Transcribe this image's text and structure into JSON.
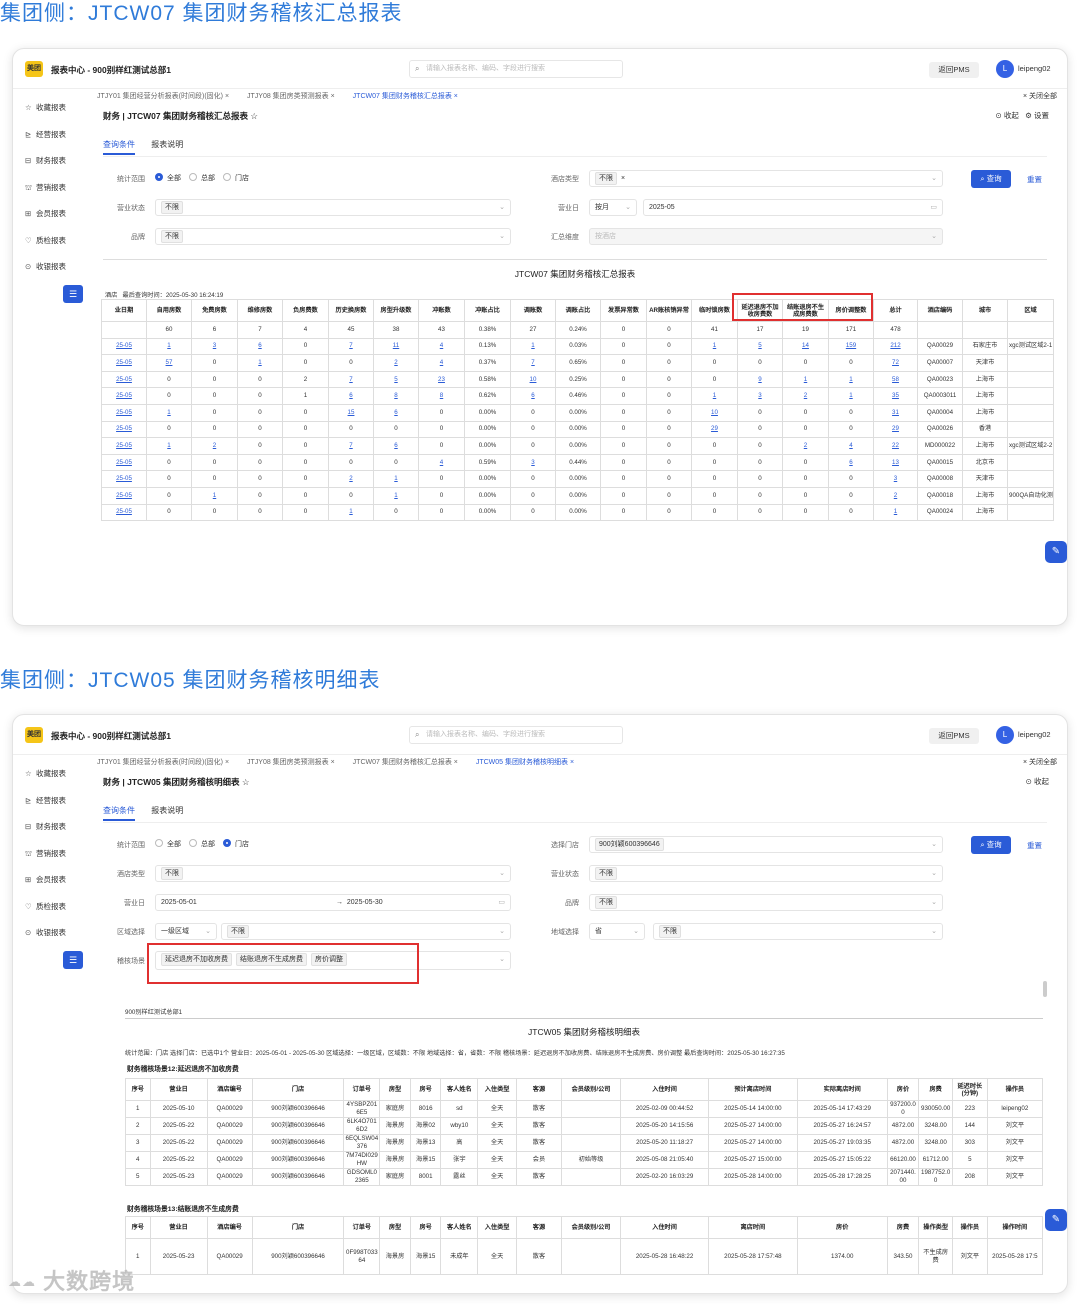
{
  "titles": {
    "top": "集团侧：JTCW07 集团财务稽核汇总报表",
    "bottom": "集团侧：JTCW05 集团财务稽核明细表"
  },
  "watermark": {
    "icon": "link-logo",
    "text": "大数跨境"
  },
  "app": {
    "logo": "美团",
    "title": "报表中心 - 900别样红测试总部1",
    "search_placeholder": "请输入报表名称、编码、字段进行搜索",
    "pms_button": "返回PMS",
    "avatar_letter": "L",
    "user": "leipeng02"
  },
  "sidebar": [
    {
      "icon": "☆",
      "label": "收藏报表"
    },
    {
      "icon": "⊵",
      "label": "经营报表"
    },
    {
      "icon": "⊟",
      "label": "财务报表"
    },
    {
      "icon": "⛫",
      "label": "营销报表"
    },
    {
      "icon": "⊞",
      "label": "会员报表"
    },
    {
      "icon": "♡",
      "label": "质检报表"
    },
    {
      "icon": "⊙",
      "label": "收银报表"
    }
  ],
  "common": {
    "close_all": "× 关闭全部",
    "collapse": "⊙ 收起",
    "settings": "⚙ 设置",
    "subtab_query": "查询条件",
    "subtab_desc": "报表说明",
    "query": "查询",
    "reset": "重置",
    "hotel_label": "酒店"
  },
  "p1": {
    "tabs": [
      "JTJY01 集团经营分析报表(时间段)(固化) ×",
      "JTJY08 集团房类预测报表 ×",
      "JTCW07 集团财务稽核汇总报表 ×"
    ],
    "page_title": "财务 | JTCW07 集团财务稽核汇总报表 ☆",
    "form": {
      "scope_label": "统计范围",
      "scope_options": [
        "全部",
        "总部",
        "门店"
      ],
      "hotel_type_label": "酒店类型",
      "hotel_type_tag": "不限",
      "status_label": "营业状态",
      "status_tag": "不限",
      "bizday_label": "营业日",
      "bizday_mode": "按月",
      "bizday_tag": "2025-05",
      "brand_label": "品牌",
      "brand_tag": "不限",
      "dimension_label": "汇总维度",
      "dimension_value": "按酒店"
    },
    "report_title": "JTCW07 集团财务稽核汇总报表",
    "meta_hotel": "酒店",
    "meta_time": "最后查询时间：2025-05-30 16:24:19",
    "headers": [
      "业日期",
      "自用房数",
      "免费房数",
      "维修房数",
      "负房费数",
      "历史换房数",
      "房型升级数",
      "冲账数",
      "冲账占比",
      "调账数",
      "调账占比",
      "发票异常数",
      "AR账核销异常",
      "临时锁房数",
      "延迟退房不加收房费数",
      "结账退房不生成房费数",
      "房价调整数",
      "总计",
      "酒店编码",
      "城市",
      "区域"
    ],
    "totals": [
      "",
      "60",
      "6",
      "7",
      "4",
      "45",
      "38",
      "43",
      "0.38%",
      "27",
      "0.24%",
      "0",
      "0",
      "41",
      "17",
      "19",
      "171",
      "478",
      "",
      "",
      ""
    ],
    "rows": [
      [
        "25-05",
        "1",
        "3",
        "6",
        "0",
        "7",
        "11",
        "4",
        "0.13%",
        "1",
        "0.03%",
        "0",
        "0",
        "1",
        "5",
        "14",
        "159",
        "212",
        "QA00029",
        "石家庄市",
        "xgc测试区域2-1"
      ],
      [
        "25-05",
        "57",
        "0",
        "1",
        "0",
        "0",
        "2",
        "4",
        "0.37%",
        "7",
        "0.65%",
        "0",
        "0",
        "0",
        "0",
        "0",
        "0",
        "72",
        "QA00007",
        "天津市",
        ""
      ],
      [
        "25-05",
        "0",
        "0",
        "0",
        "2",
        "7",
        "5",
        "23",
        "0.58%",
        "10",
        "0.25%",
        "0",
        "0",
        "0",
        "9",
        "1",
        "1",
        "58",
        "QA00023",
        "上海市",
        ""
      ],
      [
        "25-05",
        "0",
        "0",
        "0",
        "1",
        "6",
        "8",
        "8",
        "0.62%",
        "6",
        "0.46%",
        "0",
        "0",
        "1",
        "3",
        "2",
        "1",
        "35",
        "QA0003011",
        "上海市",
        ""
      ],
      [
        "25-05",
        "1",
        "0",
        "0",
        "0",
        "15",
        "6",
        "0",
        "0.00%",
        "0",
        "0.00%",
        "0",
        "0",
        "10",
        "0",
        "0",
        "0",
        "31",
        "QA00004",
        "上海市",
        ""
      ],
      [
        "25-05",
        "0",
        "0",
        "0",
        "0",
        "0",
        "0",
        "0",
        "0.00%",
        "0",
        "0.00%",
        "0",
        "0",
        "29",
        "0",
        "0",
        "0",
        "29",
        "QA00026",
        "香港",
        ""
      ],
      [
        "25-05",
        "1",
        "2",
        "0",
        "0",
        "7",
        "6",
        "0",
        "0.00%",
        "0",
        "0.00%",
        "0",
        "0",
        "0",
        "0",
        "2",
        "4",
        "22",
        "MD000022",
        "上海市",
        "xgc测试区域2-2"
      ],
      [
        "25-05",
        "0",
        "0",
        "0",
        "0",
        "0",
        "0",
        "4",
        "0.59%",
        "3",
        "0.44%",
        "0",
        "0",
        "0",
        "0",
        "0",
        "6",
        "13",
        "QA00015",
        "北京市",
        ""
      ],
      [
        "25-05",
        "0",
        "0",
        "0",
        "0",
        "2",
        "1",
        "0",
        "0.00%",
        "0",
        "0.00%",
        "0",
        "0",
        "0",
        "0",
        "0",
        "0",
        "3",
        "QA00008",
        "天津市",
        ""
      ],
      [
        "25-05",
        "0",
        "1",
        "0",
        "0",
        "0",
        "1",
        "0",
        "0.00%",
        "0",
        "0.00%",
        "0",
        "0",
        "0",
        "0",
        "0",
        "0",
        "2",
        "QA00018",
        "上海市",
        "900QA自动化测试区域"
      ],
      [
        "25-05",
        "0",
        "0",
        "0",
        "0",
        "1",
        "0",
        "0",
        "0.00%",
        "0",
        "0.00%",
        "0",
        "0",
        "0",
        "0",
        "0",
        "0",
        "1",
        "QA00024",
        "上海市",
        ""
      ]
    ]
  },
  "p2": {
    "tabs": [
      "JTJY01 集团经营分析报表(时间段)(固化) ×",
      "JTJY08 集团房类预测报表 ×",
      "JTCW07 集团财务稽核汇总报表 ×",
      "JTCW05 集团财务稽核明细表 ×"
    ],
    "page_title": "财务 | JTCW05 集团财务稽核明细表 ☆",
    "form": {
      "scope_label": "统计范围",
      "scope_options": [
        "全部",
        "总部",
        "门店"
      ],
      "hotel_select_label": "选择门店",
      "hotel_tag": "900刘颖600396646",
      "hotel_type_label": "酒店类型",
      "hotel_type_tag": "不限",
      "status_label": "营业状态",
      "status_tag": "不限",
      "bizday_label": "营业日",
      "date_from": "2025-05-01",
      "date_to": "2025-05-30",
      "brand_label": "品牌",
      "brand_tag": "不限",
      "region_label": "区域选择",
      "region_level": "一级区域",
      "region_tag": "不限",
      "geo_label": "地域选择",
      "geo_level": "省",
      "geo_tag": "不限",
      "scene_label": "稽核场景",
      "scene_tags": [
        "延迟退房不加收房费",
        "结账退房不生成房费",
        "房价调整"
      ]
    },
    "org": "900别样红测试总部1",
    "report_title": "JTCW05 集团财务稽核明细表",
    "meta": "统计范围：门店   选择门店：已选中1个   营业日：2025-05-01 - 2025-05-30   区域选择：一级区域，区域数：不限   地域选择：省，省数：不限   稽核场景：延迟退房不加收房费、结账退房不生成房费、房价调整   最后查询时间：2025-05-30 16:27:35",
    "group12": "财务稽核场景12:延迟退房不加收房费",
    "headers12": [
      "序号",
      "营业日",
      "酒店编号",
      "门店",
      "订单号",
      "房型",
      "房号",
      "客人姓名",
      "入住类型",
      "客源",
      "会员级别/公司",
      "入住时间",
      "预计离店时间",
      "实际离店时间",
      "房价",
      "房费",
      "延迟时长(分钟)",
      "操作员"
    ],
    "rows12": [
      [
        "1",
        "2025-05-10",
        "QA00029",
        "900刘颖600396646",
        "4YSBPZ016E5",
        "家庭房",
        "8016",
        "sd",
        "全天",
        "散客",
        "",
        "2025-02-09 00:44:52",
        "2025-05-14 14:00:00",
        "2025-05-14 17:43:29",
        "937200.00",
        "930050.00",
        "223",
        "leipeng02"
      ],
      [
        "2",
        "2025-05-22",
        "QA00029",
        "900刘颖600396646",
        "6LK4O7016D2",
        "海景房",
        "海景02",
        "wby10",
        "全天",
        "散客",
        "",
        "2025-05-20 14:15:56",
        "2025-05-27 14:00:00",
        "2025-05-27 16:24:57",
        "4872.00",
        "3248.00",
        "144",
        "刘文平"
      ],
      [
        "3",
        "2025-05-22",
        "QA00029",
        "900刘颖600396646",
        "6EQLSW04376",
        "海景房",
        "海景13",
        "高",
        "全天",
        "散客",
        "",
        "2025-05-20 11:18:27",
        "2025-05-27 14:00:00",
        "2025-05-27 19:03:35",
        "4872.00",
        "3248.00",
        "303",
        "刘文平"
      ],
      [
        "4",
        "2025-05-22",
        "QA00029",
        "900刘颖600396646",
        "7M74DI029HW",
        "海景房",
        "海景15",
        "张宇",
        "全天",
        "会员",
        "初始等级",
        "2025-05-08 21:05:40",
        "2025-05-27 15:00:00",
        "2025-05-27 15:05:22",
        "66120.00",
        "61712.00",
        "5",
        "刘文平"
      ],
      [
        "5",
        "2025-05-23",
        "QA00029",
        "900刘颖600396646",
        "GDSOML02365",
        "家庭房",
        "8001",
        "露丝",
        "全天",
        "散客",
        "",
        "2025-02-20 16:03:29",
        "2025-05-28 14:00:00",
        "2025-05-28 17:28:25",
        "2071440.00",
        "1987752.00",
        "208",
        "刘文平"
      ]
    ],
    "group13": "财务稽核场景13:结账退房不生成房费",
    "headers13": [
      "序号",
      "营业日",
      "酒店编号",
      "门店",
      "订单号",
      "房型",
      "房号",
      "客人姓名",
      "入住类型",
      "客源",
      "会员级别/公司",
      "入住时间",
      "离店时间",
      "房价",
      "房费",
      "操作类型",
      "操作员",
      "操作时间"
    ],
    "rows13": [
      [
        "1",
        "2025-05-23",
        "QA00029",
        "900刘颖600396646",
        "0F998T03364",
        "海景房",
        "海景15",
        "未成年",
        "全天",
        "散客",
        "",
        "2025-05-28 16:48:22",
        "2025-05-28 17:57:48",
        "1374.00",
        "343.50",
        "不生成房费",
        "刘文平",
        "2025-05-28 17:5"
      ]
    ]
  }
}
